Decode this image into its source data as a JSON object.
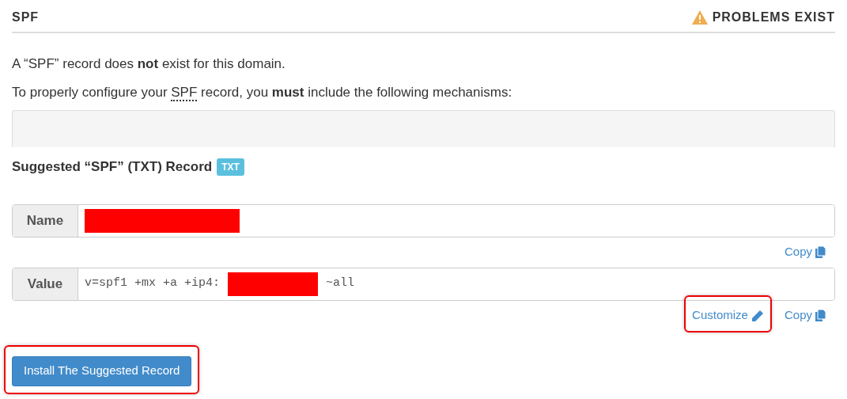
{
  "header": {
    "title": "SPF",
    "status": "PROBLEMS EXIST"
  },
  "paragraphs": [
    {
      "before": "A “SPF” record does **not** exist for this domain."
    },
    {
      "before": "To properly configure your ",
      "abbr": "SPF",
      "after": " record, you **must** include the following mechanisms:"
    }
  ],
  "suggested": {
    "heading": "Suggested “SPF” (TXT) Record",
    "badge": "TXT"
  },
  "fields": [
    {
      "label": "Name",
      "parts": [
        {
          "kind": "redacted"
        }
      ],
      "links": [
        {
          "kind": "copy",
          "text": "Copy",
          "highlighted": false
        }
      ]
    },
    {
      "label": "Value",
      "parts": [
        {
          "kind": "text",
          "text": "v=spf1 +mx +a +ip4:"
        },
        {
          "kind": "redacted"
        },
        {
          "kind": "text",
          "text": "~all"
        }
      ],
      "links": [
        {
          "kind": "customize",
          "text": "Customize",
          "highlighted": true
        },
        {
          "kind": "copy",
          "text": "Copy",
          "highlighted": false
        }
      ]
    }
  ],
  "install_button": {
    "label": "Install The Suggested Record",
    "highlighted": true
  }
}
